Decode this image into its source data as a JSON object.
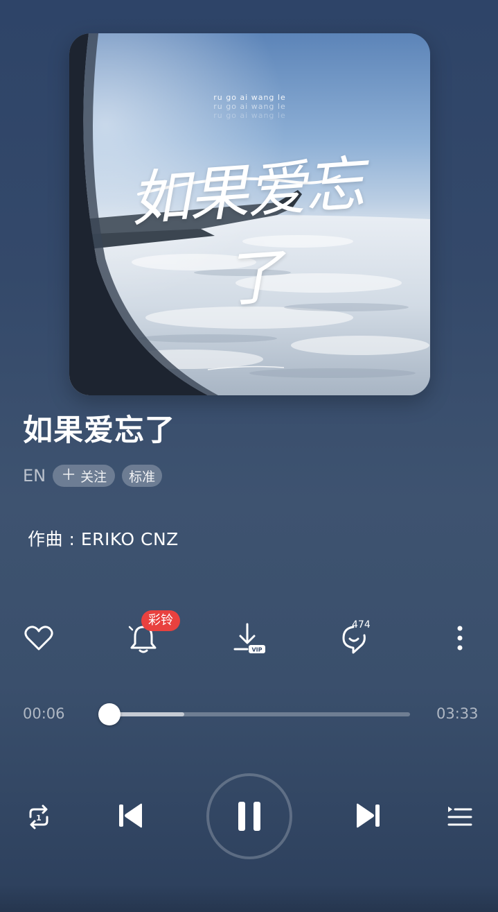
{
  "cover": {
    "pinyin_lines": [
      "ru go ai wang le",
      "ru go ai wang le",
      "ru go ai wang le"
    ],
    "title_art": "如果爱忘了",
    "signature": "Cn"
  },
  "song": {
    "title": "如果爱忘了",
    "artist": "EN",
    "follow_label": "关注",
    "quality_label": "标准",
    "credit": "作曲 : ERIKO CNZ"
  },
  "actions": {
    "ringtone_badge": "彩铃",
    "download_badge": "VIP",
    "comment_count": "474"
  },
  "player": {
    "current_time": "00:06",
    "total_time": "03:33",
    "progress_fraction": 0.03,
    "buffered_fraction": 0.27,
    "state": "playing"
  },
  "icons": {
    "like": "heart-icon",
    "ringtone": "bell-icon",
    "download": "download-icon",
    "comments": "comment-icon",
    "more": "more-vertical-icon",
    "repeat": "repeat-one-icon",
    "prev": "skip-previous-icon",
    "pause": "pause-icon",
    "next": "skip-next-icon",
    "playlist": "playlist-icon"
  },
  "colors": {
    "badge_red": "#e8413f",
    "background_top": "#2e4468",
    "background_bottom": "#2c3f5c"
  }
}
